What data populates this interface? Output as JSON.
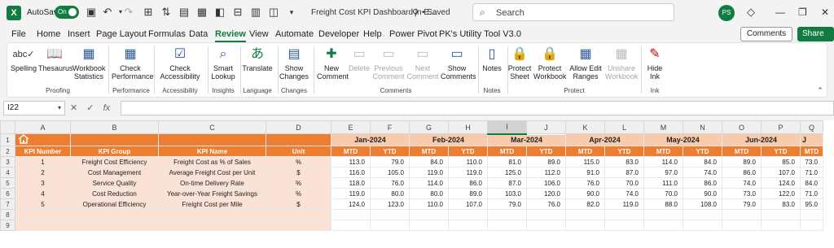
{
  "titlebar": {
    "autosave_label": "AutoSave",
    "autosave_state": "On",
    "doc_title": "Freight Cost KPI Dashboard in E...",
    "saved_status": "• Saved",
    "search_placeholder": "Search",
    "avatar_initials": "PS",
    "window_min": "—",
    "window_restore": "❐",
    "window_close": "✕"
  },
  "menu": {
    "tabs": [
      "File",
      "Home",
      "Insert",
      "Page Layout",
      "Formulas",
      "Data",
      "Review",
      "View",
      "Automate",
      "Developer",
      "Help",
      "Power Pivot",
      "PK's Utility Tool V3.0"
    ],
    "active_tab": "Review",
    "comments_label": "Comments",
    "share_label": "Share"
  },
  "ribbon": {
    "buttons": [
      {
        "label": "Spelling",
        "icon": "spelling-icon",
        "enabled": true
      },
      {
        "label": "Thesaurus",
        "icon": "thesaurus-icon",
        "enabled": true
      },
      {
        "label": "Workbook Statistics",
        "icon": "workbook-statistics-icon",
        "enabled": true
      },
      {
        "label": "Check Performance",
        "icon": "check-performance-icon",
        "enabled": true
      },
      {
        "label": "Check Accessibility",
        "icon": "check-accessibility-icon",
        "enabled": true
      },
      {
        "label": "Smart Lookup",
        "icon": "smart-lookup-icon",
        "enabled": true
      },
      {
        "label": "Translate",
        "icon": "translate-icon",
        "enabled": true
      },
      {
        "label": "Show Changes",
        "icon": "show-changes-icon",
        "enabled": true
      },
      {
        "label": "New Comment",
        "icon": "new-comment-icon",
        "enabled": true
      },
      {
        "label": "Delete",
        "icon": "delete-comment-icon",
        "enabled": false
      },
      {
        "label": "Previous Comment",
        "icon": "previous-comment-icon",
        "enabled": false
      },
      {
        "label": "Next Comment",
        "icon": "next-comment-icon",
        "enabled": false
      },
      {
        "label": "Show Comments",
        "icon": "show-comments-icon",
        "enabled": true
      },
      {
        "label": "Notes",
        "icon": "notes-icon",
        "enabled": true
      },
      {
        "label": "Protect Sheet",
        "icon": "protect-sheet-icon",
        "enabled": true
      },
      {
        "label": "Protect Workbook",
        "icon": "protect-workbook-icon",
        "enabled": true
      },
      {
        "label": "Allow Edit Ranges",
        "icon": "allow-edit-ranges-icon",
        "enabled": true
      },
      {
        "label": "Unshare Workbook",
        "icon": "unshare-workbook-icon",
        "enabled": false
      },
      {
        "label": "Hide Ink",
        "icon": "hide-ink-icon",
        "enabled": true
      }
    ],
    "groups": [
      "Proofing",
      "Performance",
      "Accessibility",
      "Insights",
      "Language",
      "Changes",
      "Comments",
      "Notes",
      "Protect",
      "Ink"
    ]
  },
  "formula_bar": {
    "name_box": "I22",
    "fx": "fx",
    "formula": ""
  },
  "sheet": {
    "columns": [
      "A",
      "B",
      "C",
      "D",
      "E",
      "F",
      "G",
      "H",
      "I",
      "J",
      "K",
      "L",
      "M",
      "N",
      "O",
      "P",
      "Q"
    ],
    "selected_column": "I",
    "row_numbers": [
      "1",
      "2",
      "3",
      "4",
      "5",
      "6",
      "7",
      "8",
      "9"
    ],
    "months": [
      "Jan-2024",
      "Feb-2024",
      "Mar-2024",
      "Apr-2024",
      "May-2024",
      "Jun-2024",
      "J"
    ],
    "headers": [
      "KPI Number",
      "KPI Group",
      "KPI Name",
      "Unit"
    ],
    "sub_headers": [
      "MTD",
      "YTD"
    ],
    "rows": [
      {
        "num": "1",
        "group": "Freight Cost Efficiency",
        "name": "Freight Cost as % of Sales",
        "unit": "%",
        "values": [
          "113.0",
          "79.0",
          "84.0",
          "110.0",
          "81.0",
          "89.0",
          "115.0",
          "83.0",
          "114.0",
          "84.0",
          "89.0",
          "85.0",
          "73.0"
        ]
      },
      {
        "num": "2",
        "group": "Cost Management",
        "name": "Average Freight Cost per Unit",
        "unit": "$",
        "values": [
          "116.0",
          "105.0",
          "119.0",
          "119.0",
          "125.0",
          "112.0",
          "91.0",
          "87.0",
          "97.0",
          "74.0",
          "86.0",
          "107.0",
          "71.0"
        ]
      },
      {
        "num": "3",
        "group": "Service Quality",
        "name": "On-time Delivery Rate",
        "unit": "%",
        "values": [
          "118.0",
          "76.0",
          "114.0",
          "86.0",
          "87.0",
          "106.0",
          "76.0",
          "70.0",
          "111.0",
          "86.0",
          "74.0",
          "124.0",
          "84.0"
        ]
      },
      {
        "num": "4",
        "group": "Cost Reduction",
        "name": "Year-over-Year Freight Savings",
        "unit": "%",
        "values": [
          "119.0",
          "80.0",
          "80.0",
          "89.0",
          "103.0",
          "120.0",
          "90.0",
          "74.0",
          "70.0",
          "90.0",
          "73.0",
          "122.0",
          "71.0"
        ]
      },
      {
        "num": "5",
        "group": "Operational Efficiency",
        "name": "Freight Cost per Mile",
        "unit": "$",
        "values": [
          "124.0",
          "123.0",
          "110.0",
          "107.0",
          "79.0",
          "76.0",
          "82.0",
          "119.0",
          "88.0",
          "108.0",
          "79.0",
          "83.0",
          "95.0"
        ]
      }
    ]
  },
  "colors": {
    "excel_green": "#107c41",
    "header_orange": "#ed7d31",
    "month_peach": "#f8cbad",
    "body_peach": "#fbe2d5"
  }
}
